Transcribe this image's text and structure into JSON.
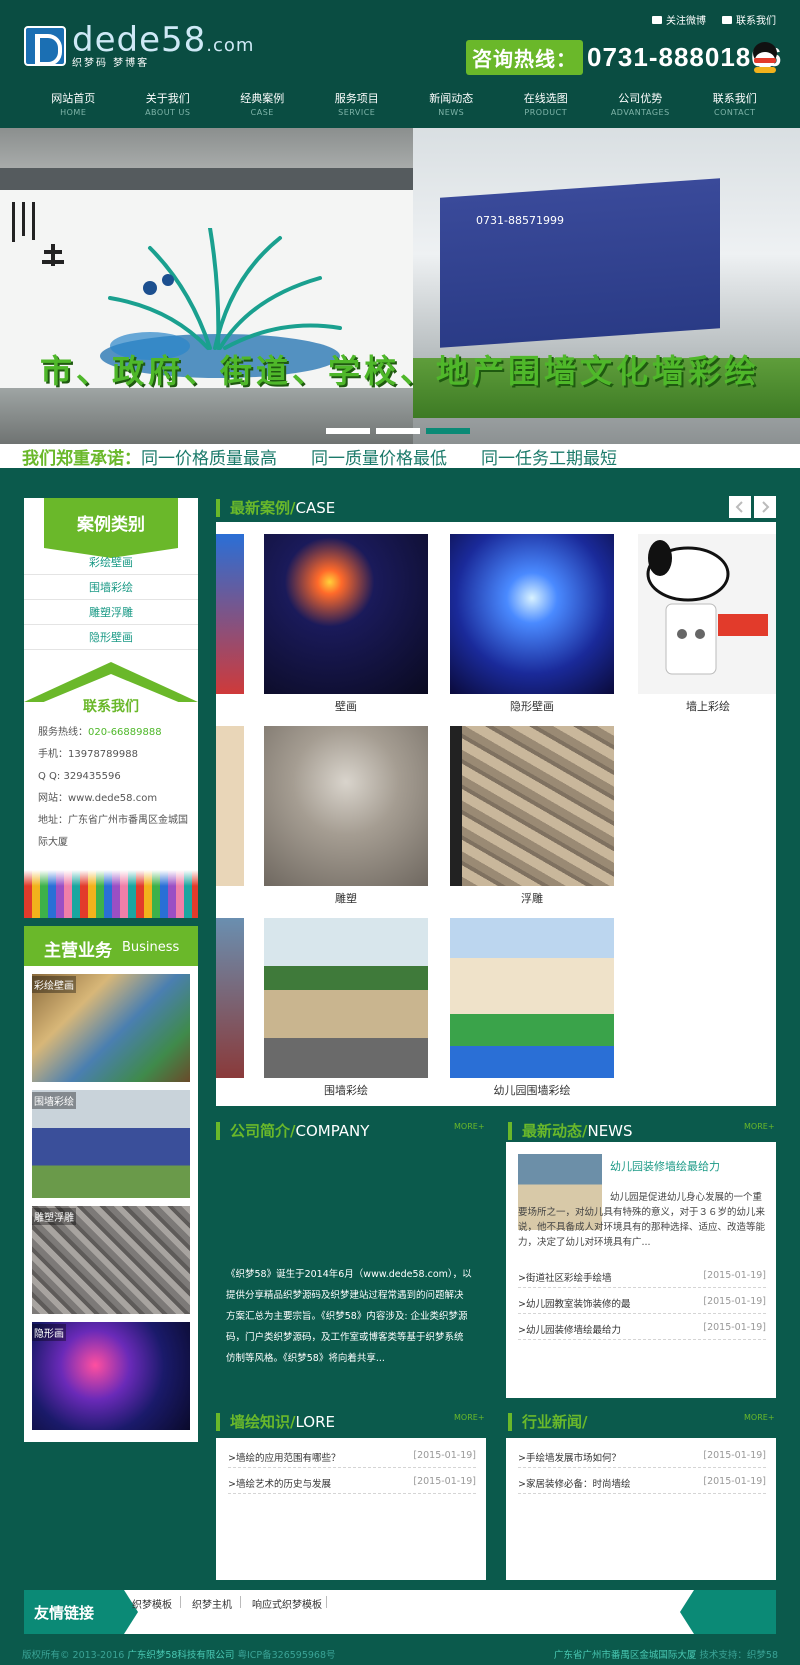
{
  "header": {
    "logo_main": "dede",
    "logo_num": "58",
    "logo_suffix": ".com",
    "logo_sub": "织梦码 梦博客",
    "top_links": [
      "关注微博",
      "联系我们"
    ],
    "hotline_label": "咨询热线：",
    "hotline_number": "0731-88801806"
  },
  "nav": [
    {
      "cn": "网站首页",
      "en": "HOME"
    },
    {
      "cn": "关于我们",
      "en": "ABOUT US"
    },
    {
      "cn": "经典案例",
      "en": "CASE"
    },
    {
      "cn": "服务项目",
      "en": "SERVICE"
    },
    {
      "cn": "新闻动态",
      "en": "NEWS"
    },
    {
      "cn": "在线选图",
      "en": "PRODUCT"
    },
    {
      "cn": "公司优势",
      "en": "ADVANTAGES"
    },
    {
      "cn": "联系我们",
      "en": "CONTACT"
    }
  ],
  "banner": {
    "caption": "市、政府、街道、学校、地产围墙文化墙彩绘",
    "billboard_text": "0731-88571999",
    "dots": 3,
    "active_dot": 3
  },
  "promise": {
    "label": "我们郑重承诺：",
    "items": [
      "同一价格质量最高",
      "同一质量价格最低",
      "同一任务工期最短"
    ]
  },
  "sidebar": {
    "case_title": "案例类别",
    "categories": [
      "彩绘壁画",
      "围墙彩绘",
      "雕塑浮雕",
      "隐形壁画"
    ],
    "contact_title": "联系我们",
    "contact": {
      "hotline_label": "服务热线：",
      "hotline": "020-66889888",
      "mobile": "手机：13978789988",
      "qq": "Q Q: 329435596",
      "site": "网站：www.dede58.com",
      "address": "地址：广东省广州市番禺区金城国际大厦"
    },
    "biz_title": "主营业务",
    "biz_title_en": "Business",
    "biz_items": [
      "彩绘壁画",
      "围墙彩绘",
      "雕塑浮雕",
      "隐形画"
    ]
  },
  "cases": {
    "title": "最新案例/",
    "title_en": "CASE",
    "items": [
      "壁画",
      "隐形壁画",
      "墙上彩绘",
      "雕塑",
      "浮雕",
      "围墙彩绘",
      "幼儿园围墙彩绘"
    ]
  },
  "company": {
    "title": "公司简介/",
    "title_en": "COMPANY",
    "more": "MORE+",
    "text": "《织梦58》诞生于2014年6月（www.dede58.com），以提供分享精品织梦源码及织梦建站过程常遇到的问题解决方案汇总为主要宗旨。《织梦58》内容涉及: 企业类织梦源码，门户类织梦源码，及工作室或博客类等基于织梦系统仿制等风格。《织梦58》将向着共享..."
  },
  "news": {
    "title": "最新动态/",
    "title_en": "NEWS",
    "more": "MORE+",
    "feature_title": "幼儿园装修墙绘最给力",
    "feature_text": "幼儿园是促进幼儿身心发展的一个重要场所之一，对幼儿具有特殊的意义，对于３６岁的幼儿来说，他不具备成人对环境具有的那种选择、适应、改造等能力，决定了幼儿对环境具有广...",
    "list": [
      {
        "title": ">街道社区彩绘手绘墙",
        "date": "[2015-01-19]"
      },
      {
        "title": ">幼儿园教室装饰装修的最",
        "date": "[2015-01-19]"
      },
      {
        "title": ">幼儿园装修墙绘最给力",
        "date": "[2015-01-19]"
      }
    ]
  },
  "lore": {
    "title": "墙绘知识/",
    "title_en": "LORE",
    "more": "MORE+",
    "list": [
      {
        "title": ">墙绘的应用范围有哪些？",
        "date": "[2015-01-19]"
      },
      {
        "title": ">墙绘艺术的历史与发展",
        "date": "[2015-01-19]"
      }
    ]
  },
  "industry": {
    "title": "行业新闻/",
    "title_en": "",
    "more": "MORE+",
    "list": [
      {
        "title": ">手绘墙发展市场如何？",
        "date": "[2015-01-19]"
      },
      {
        "title": ">家居装修必备：时尚墙绘",
        "date": "[2015-01-19]"
      }
    ]
  },
  "links": {
    "title": "友情链接",
    "items": [
      "织梦模板",
      "织梦主机",
      "响应式织梦模板"
    ]
  },
  "footer": {
    "left_prefix": "版权所有© 2013-2016 ",
    "company": "广东织梦58科技有限公司",
    "icp": " 粤ICP备326595968号",
    "address": "广东省广州市番禺区金城国际大厦",
    "support": " 技术支持：织梦58"
  },
  "colors": {
    "accent_green": "#6ab82a",
    "dark_teal": "#0a4d42",
    "teal": "#0b8a76"
  }
}
